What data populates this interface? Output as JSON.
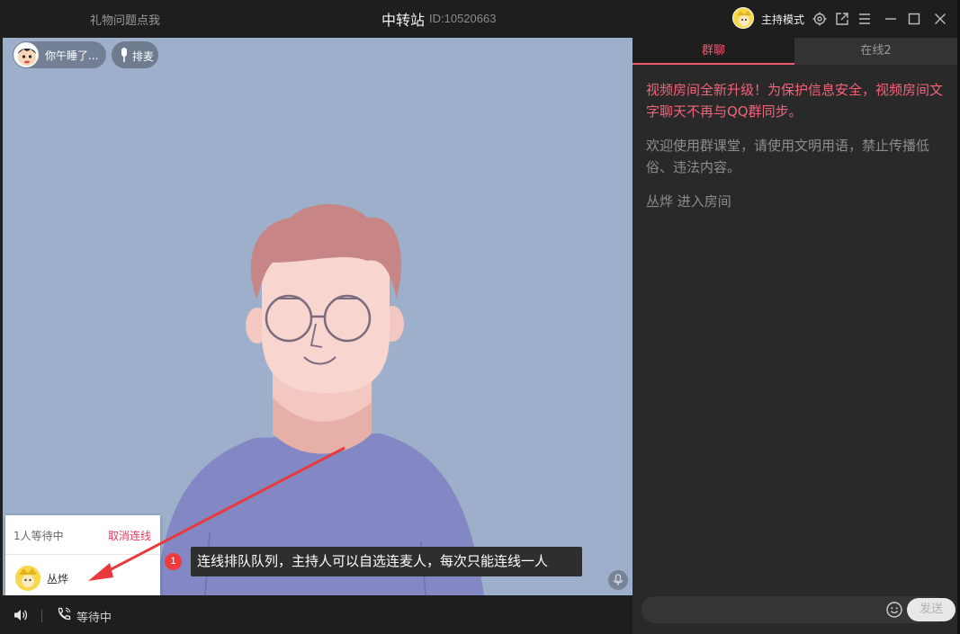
{
  "titlebar": {
    "gift_link": "礼物问题点我",
    "title": "中转站",
    "room_id": "ID:10520663",
    "host_mode": "主持模式"
  },
  "icons": {
    "settings": "gear-icon",
    "share": "share-icon",
    "menu": "menu-icon",
    "minimize": "minimize-icon",
    "maximize": "maximize-icon",
    "close": "close-icon"
  },
  "video": {
    "speaker_name": "你午睡了...",
    "queue_label": "排麦"
  },
  "queue_panel": {
    "count_text": "1人等待中",
    "cancel_label": "取消连线",
    "waiting_user": "丛烨"
  },
  "callout": {
    "number": "1",
    "text": "连线排队队列，主持人可以自选连麦人，每次只能连线一人"
  },
  "bottom_bar": {
    "status": "等待中"
  },
  "right_panel": {
    "tabs": [
      {
        "label": "群聊",
        "active": true
      },
      {
        "label": "在线2",
        "active": false
      }
    ],
    "messages": [
      {
        "type": "warn",
        "text": "视频房间全新升级！为保护信息安全，视频房间文字聊天不再与QQ群同步。"
      },
      {
        "type": "info",
        "text": "欢迎使用群课堂，请使用文明用语，禁止传播低俗、违法内容。"
      },
      {
        "type": "info",
        "text": "丛烨 进入房间"
      }
    ],
    "send_label": "发送"
  },
  "colors": {
    "accent": "#ee5a6f",
    "warn_text": "#f2637a",
    "video_bg": "#9dafca",
    "callout_badge": "#ef3b3b"
  }
}
